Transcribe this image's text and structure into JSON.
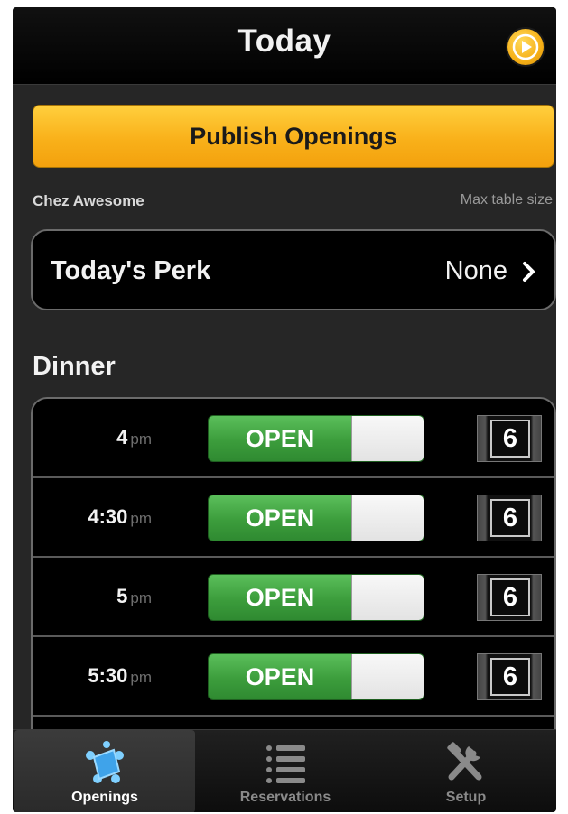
{
  "header": {
    "title": "Today",
    "action_icon": "play-circle-icon",
    "accent": "#f6b017"
  },
  "publish": {
    "label": "Publish Openings",
    "color": "#f9b11a"
  },
  "restaurant": {
    "name": "Chez Awesome",
    "max_table_label": "Max table size"
  },
  "perk": {
    "label": "Today's Perk",
    "value": "None"
  },
  "section": {
    "label": "Dinner"
  },
  "slots": [
    {
      "time": "4",
      "ampm": "pm",
      "status": "OPEN",
      "size": "6"
    },
    {
      "time": "4:30",
      "ampm": "pm",
      "status": "OPEN",
      "size": "6"
    },
    {
      "time": "5",
      "ampm": "pm",
      "status": "OPEN",
      "size": "6"
    },
    {
      "time": "5:30",
      "ampm": "pm",
      "status": "OPEN",
      "size": "6"
    }
  ],
  "tabs": [
    {
      "label": "Openings",
      "icon": "openings-icon",
      "active": true
    },
    {
      "label": "Reservations",
      "icon": "list-icon",
      "active": false
    },
    {
      "label": "Setup",
      "icon": "tools-icon",
      "active": false
    }
  ],
  "colors": {
    "open_green": "#3c9d3c",
    "background": "#262626"
  }
}
